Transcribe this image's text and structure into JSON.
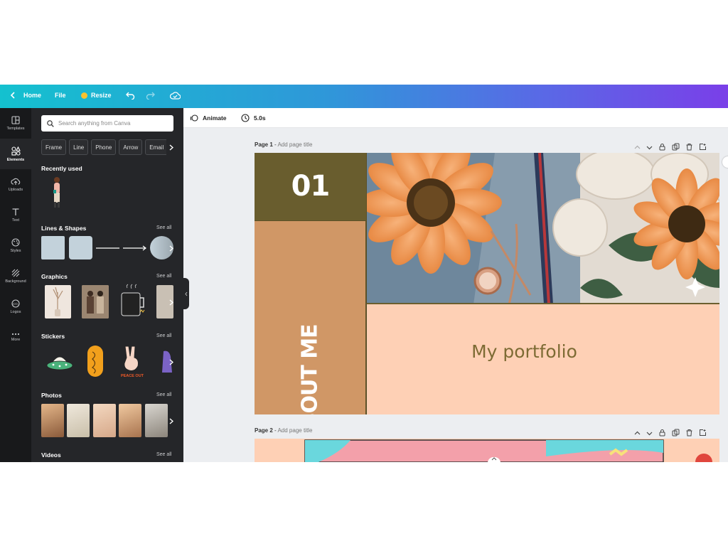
{
  "topbar": {
    "home_label": "Home",
    "file_label": "File",
    "resize_label": "Resize",
    "gradient_start": "#14c1cf",
    "gradient_end": "#7a3fe8"
  },
  "rail": {
    "items": [
      {
        "label": "Templates",
        "icon": "templates-icon"
      },
      {
        "label": "Elements",
        "icon": "elements-icon"
      },
      {
        "label": "Uploads",
        "icon": "uploads-icon"
      },
      {
        "label": "Text",
        "icon": "text-icon"
      },
      {
        "label": "Styles",
        "icon": "styles-icon"
      },
      {
        "label": "Background",
        "icon": "background-icon"
      },
      {
        "label": "Logos",
        "icon": "logos-icon"
      },
      {
        "label": "More",
        "icon": "more-icon"
      }
    ]
  },
  "panel": {
    "search_placeholder": "Search anything from Canva",
    "chips": [
      "Frame",
      "Line",
      "Phone",
      "Arrow",
      "Email"
    ],
    "recently_used": "Recently used",
    "lines_shapes": "Lines & Shapes",
    "graphics": "Graphics",
    "stickers": "Stickers",
    "photos": "Photos",
    "videos": "Videos",
    "see_all": "See all",
    "sticker_caption": "PEACE OUT"
  },
  "subbar": {
    "animate_label": "Animate",
    "duration_label": "5.0s"
  },
  "pages": [
    {
      "label": "Page 1",
      "sep": " - ",
      "add_title": "Add page title"
    },
    {
      "label": "Page 2",
      "sep": " - ",
      "add_title": "Add page title"
    }
  ],
  "slide": {
    "number": "01",
    "about": "ABOUT ME",
    "portfolio": "My portfolio",
    "olive": "#695d2e",
    "tan": "#d09766",
    "peach": "#fed0b5",
    "text_color": "#7d6b34"
  }
}
